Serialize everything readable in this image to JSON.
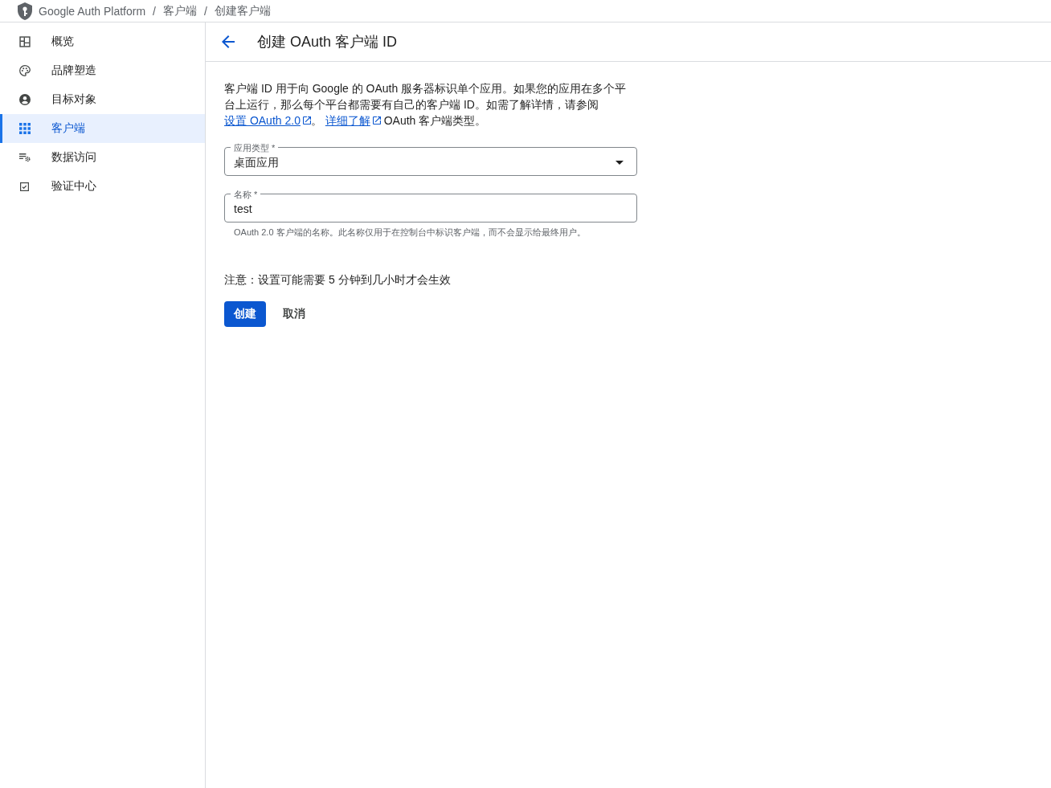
{
  "breadcrumb": [
    {
      "label": "Google Auth Platform"
    },
    {
      "separator": "/",
      "label": "客户端"
    },
    {
      "separator": "/",
      "label": "创建客户端"
    }
  ],
  "sidebar": {
    "items": [
      {
        "label": "概览",
        "selected": false
      },
      {
        "label": "品牌塑造",
        "selected": false
      },
      {
        "label": "目标对象",
        "selected": false
      },
      {
        "label": "客户端",
        "selected": true
      },
      {
        "label": "数据访问",
        "selected": false
      },
      {
        "label": "验证中心",
        "selected": false
      }
    ]
  },
  "page_header": {
    "title": "创建 OAuth 客户端 ID"
  },
  "intro": [
    {
      "kind": "text",
      "text": "客户端 ID 用于向 Google 的 OAuth 服务器标识单个应用。如果您的应用在多个平台上运行，那么每个平台都需要有自己的客户端 ID。如需了解详情，请参阅"
    },
    {
      "kind": "link",
      "text": "设置 OAuth 2.0",
      "external": true
    },
    {
      "kind": "text",
      "text": "。 "
    },
    {
      "kind": "link",
      "text": "详细了解",
      "external": true
    },
    {
      "kind": "text",
      "text": " OAuth 客户端类型。"
    }
  ],
  "fields": [
    {
      "kind": "select",
      "label": "应用类型 *",
      "value": "桌面应用"
    },
    {
      "kind": "text",
      "label": "名称 *",
      "value": "test",
      "helper": "OAuth 2.0 客户端的名称。此名称仅用于在控制台中标识客户端，而不会显示给最终用户。"
    }
  ],
  "note": "注意：设置可能需要 5 分钟到几小时才会生效",
  "buttons": [
    {
      "label": "创建",
      "kind": "primary"
    },
    {
      "label": "取消",
      "kind": "text"
    }
  ]
}
